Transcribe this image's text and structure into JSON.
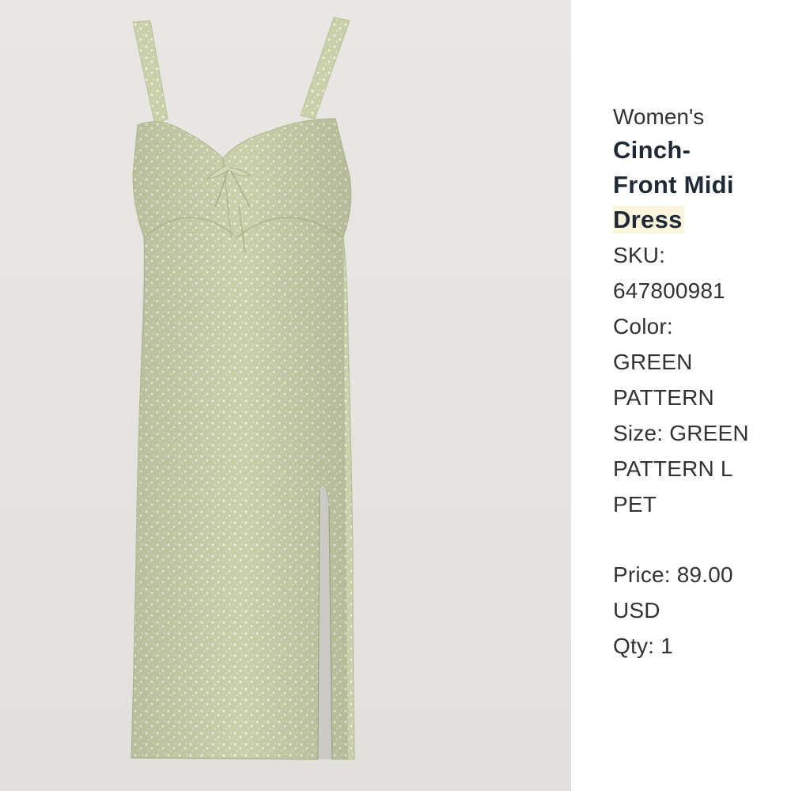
{
  "product": {
    "gender": "Women's",
    "title_lines": [
      "Cinch-",
      "Front Midi",
      "Dress"
    ],
    "sku_label": "SKU:",
    "sku_value": "647800981",
    "color_label": "Color:",
    "color_lines": [
      "GREEN",
      "PATTERN"
    ],
    "size_lines": [
      "Size: GREEN",
      "PATTERN L",
      "PET"
    ],
    "price_lines": [
      "Price: 89.00",
      "USD"
    ],
    "qty_line": "Qty: 1"
  },
  "image": {
    "subject": "green patterned midi slip dress",
    "dress_color": "#c9d0ac",
    "background_color": "#e7e5e2"
  },
  "colors": {
    "title_text": "#1f2a36",
    "body_text": "#333333",
    "highlight": "#fbf5dc"
  }
}
